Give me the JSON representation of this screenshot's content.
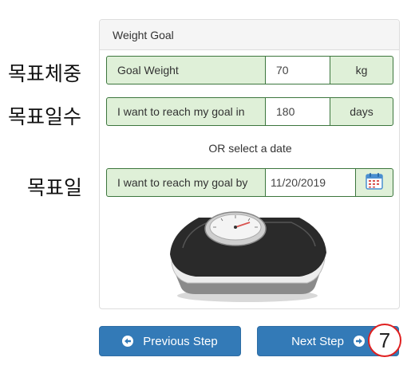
{
  "annotations": {
    "target_weight": "목표체중",
    "target_days": "목표일수",
    "target_date": "목표일",
    "step_number": "7"
  },
  "panel": {
    "title": "Weight Goal",
    "goal_weight": {
      "label": "Goal Weight",
      "value": "70",
      "unit": "kg"
    },
    "goal_days": {
      "label": "I want to reach my goal in",
      "value": "180",
      "unit": "days"
    },
    "or_text": "OR select a date",
    "goal_date": {
      "label": "I want to reach my goal by",
      "value": "11/20/2019"
    }
  },
  "buttons": {
    "previous": "Previous Step",
    "next": "Next Step"
  },
  "colors": {
    "addon_bg": "#dff0d8",
    "addon_border": "#3c763d",
    "button_bg": "#337ab7",
    "badge_border": "#e02020"
  },
  "icons": {
    "previous": "arrow-circle-left-icon",
    "next": "arrow-circle-right-icon",
    "calendar": "calendar-icon"
  }
}
